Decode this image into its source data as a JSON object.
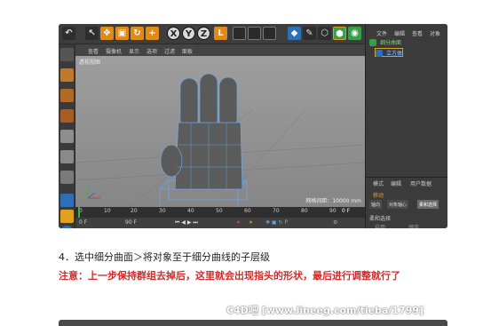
{
  "toolbar": {
    "undo_icon": "undo-icon",
    "x_label": "X",
    "y_label": "Y",
    "z_label": "Z"
  },
  "viewport": {
    "menu": [
      "查看",
      "摄像机",
      "显示",
      "选项",
      "过滤",
      "面板"
    ],
    "label": "透视视图",
    "grid_spacing": "网格间距：10000 mm"
  },
  "timeline": {
    "ticks": [
      "0",
      "10",
      "20",
      "30",
      "40",
      "50",
      "60",
      "70",
      "80",
      "90"
    ],
    "current_frame": "0 F",
    "start_frame": "0 F",
    "end_frame": "90 F",
    "max_frame": "90 F"
  },
  "object_manager": {
    "menu": [
      "文件",
      "编辑",
      "查看",
      "对象"
    ],
    "objects": [
      {
        "name": "细分曲面",
        "color": "#7bd66a"
      },
      {
        "name": "立方体",
        "color": "#9fd6ff",
        "selected": true
      }
    ]
  },
  "attribute_manager": {
    "menu": [
      "模式",
      "编辑",
      "用户数据"
    ],
    "title": "移动",
    "tabs": [
      "轴向",
      "对象轴心",
      "柔和选择"
    ],
    "active_tab": "柔和选择",
    "section": "柔和选择",
    "rows": [
      "启用",
      "预览",
      "表面",
      "橡皮",
      "模式"
    ]
  },
  "coordinates": {
    "menu": [
      "创建",
      "编辑",
      "功能",
      "纹理"
    ],
    "position_label": "位置",
    "size_label": "尺寸",
    "rotation_label": "旋转",
    "x_pos": "0 cm",
    "x_size": "0 mm",
    "h_rot": "0 °"
  },
  "article": {
    "step": "4．选中细分曲面＞将对象至于细分曲线的子层级",
    "note": "注意：上一步保持群组去掉后，这里就会出现指头的形状，最后进行调整就行了",
    "watermark": "C4D吧 [www.lineeg.com/tieba/1799]"
  },
  "colors": {
    "accent_orange": "#e08a1a",
    "note_red": "#d12a2a",
    "mesh_blue": "#6aa8e8"
  }
}
